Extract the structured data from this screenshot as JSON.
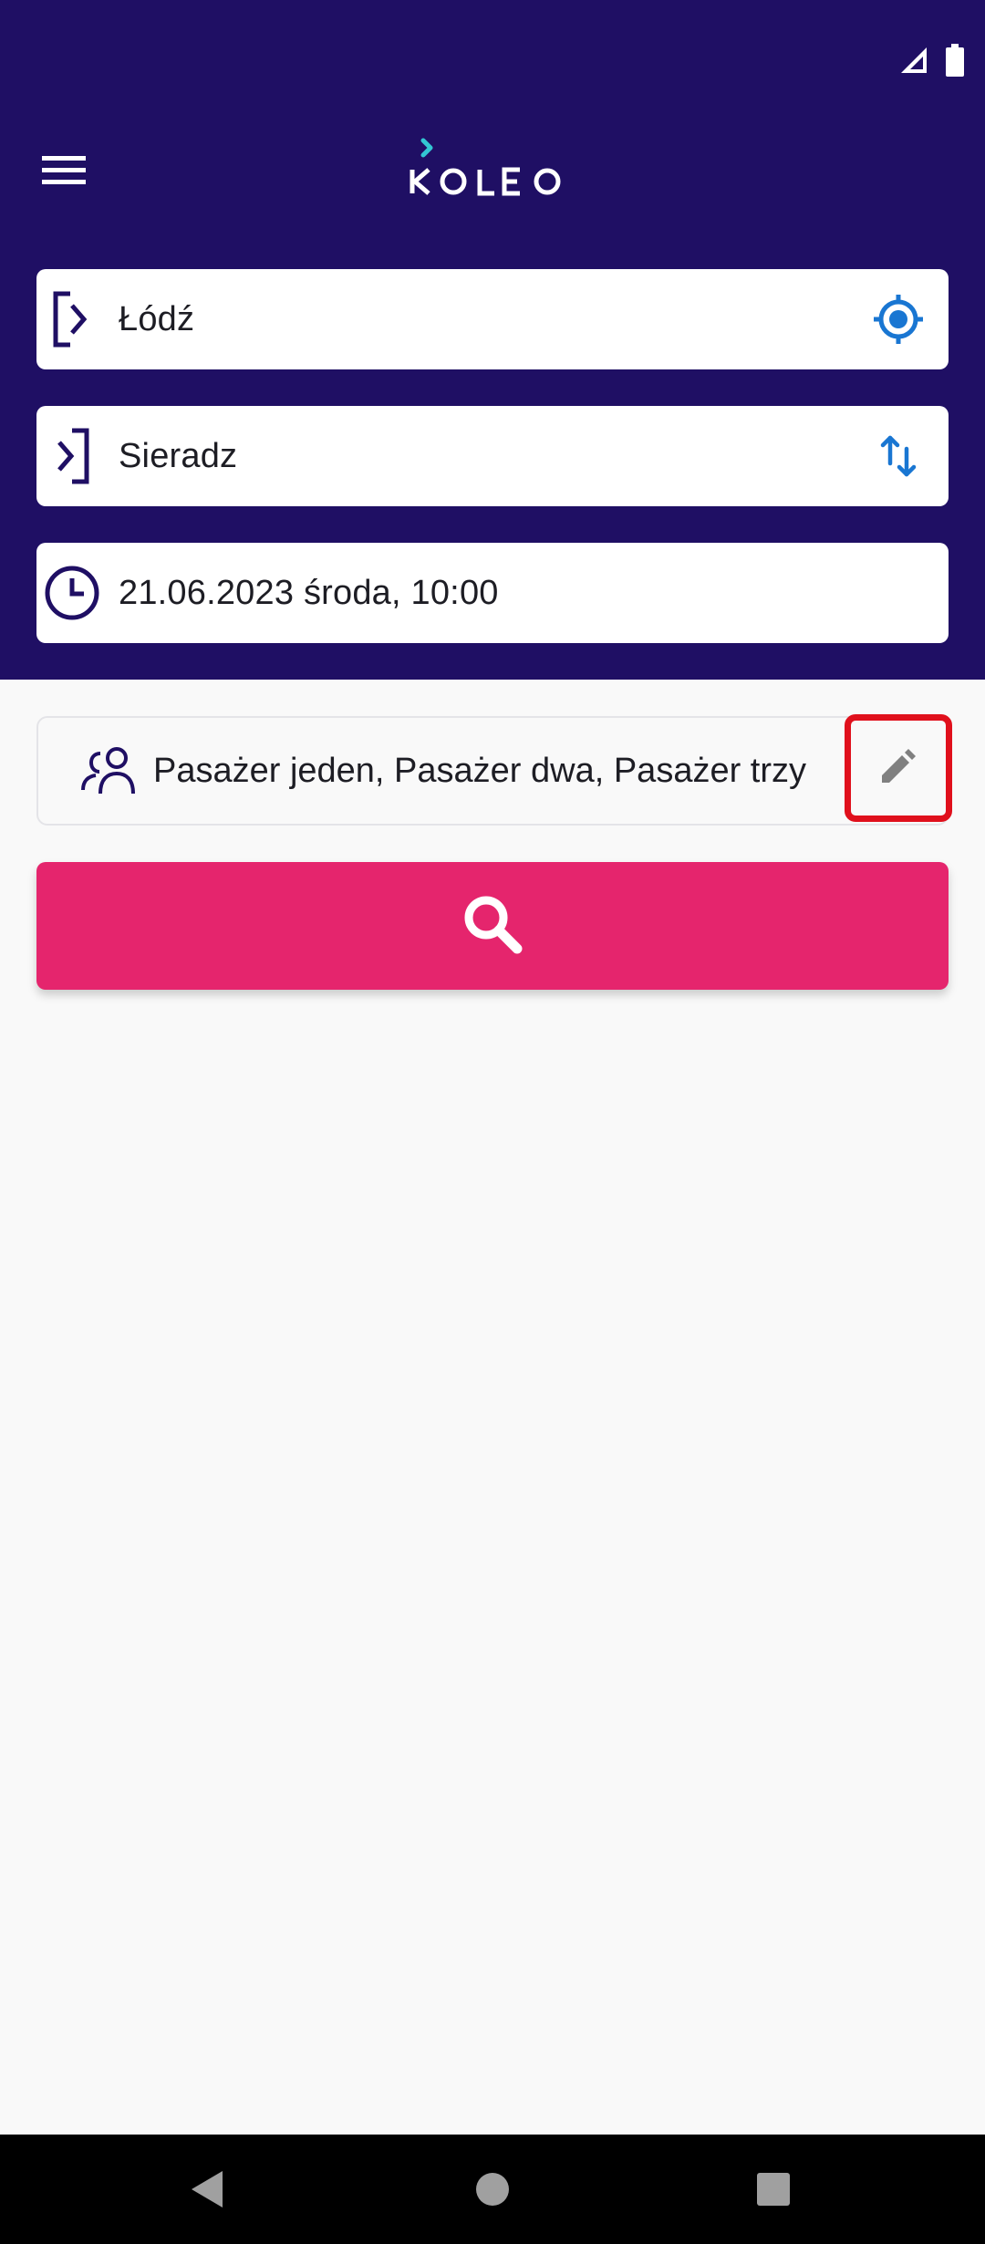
{
  "app": {
    "name": "KOLEO"
  },
  "colors": {
    "header_bg": "#1f0f64",
    "accent_blue": "#1976d2",
    "search_pink": "#e5256d",
    "highlight_red": "#e0101c"
  },
  "status_bar": {
    "icons": [
      "signal-icon",
      "battery-icon"
    ]
  },
  "header": {
    "menu_icon": "hamburger-menu-icon",
    "logo_text": "KOLEO"
  },
  "search_form": {
    "from": {
      "value": "Łódź",
      "icon": "departure-icon",
      "action_icon": "locate-icon"
    },
    "to": {
      "value": "Sieradz",
      "icon": "arrival-icon",
      "action_icon": "swap-icon"
    },
    "datetime": {
      "value": "21.06.2023 środa, 10:00",
      "icon": "clock-icon"
    },
    "passengers": {
      "value": "Pasażer jeden, Pasażer dwa, Pasażer trzy",
      "icon": "people-icon",
      "action_icon": "edit-pencil-icon"
    },
    "search_button_icon": "search-icon"
  },
  "nav_bar": {
    "items": [
      "back-icon",
      "home-icon",
      "recents-icon"
    ]
  }
}
